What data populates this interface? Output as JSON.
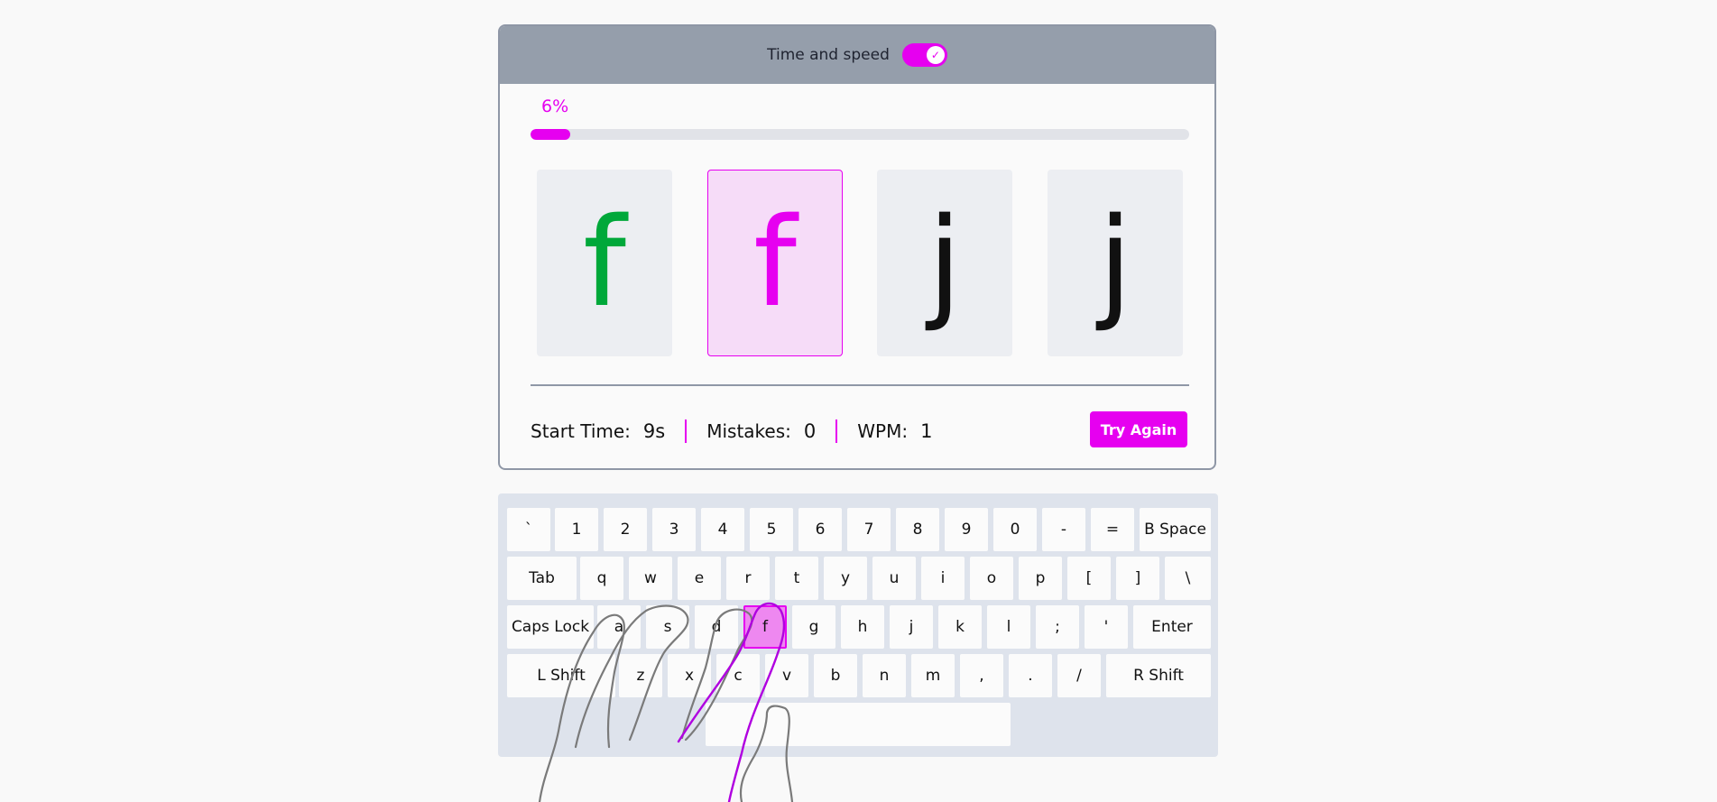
{
  "header": {
    "toggle_label": "Time and speed",
    "toggle_on": true,
    "toggle_check": "✓"
  },
  "progress": {
    "percent_label": "6%",
    "fraction": 0.06
  },
  "letters": [
    {
      "char": "f",
      "state": "done"
    },
    {
      "char": "f",
      "state": "current"
    },
    {
      "char": "j",
      "state": "pending"
    },
    {
      "char": "j",
      "state": "pending"
    }
  ],
  "stats": {
    "start_time_label": "Start Time:",
    "start_time_value": "9s",
    "mistakes_label": "Mistakes:",
    "mistakes_value": "0",
    "wpm_label": "WPM:",
    "wpm_value": "1"
  },
  "try_again_label": "Try Again",
  "keyboard": {
    "rows": [
      [
        "`",
        "1",
        "2",
        "3",
        "4",
        "5",
        "6",
        "7",
        "8",
        "9",
        "0",
        "-",
        "=",
        "B Space"
      ],
      [
        "Tab",
        "q",
        "w",
        "e",
        "r",
        "t",
        "y",
        "u",
        "i",
        "o",
        "p",
        "[",
        "]",
        "\\"
      ],
      [
        "Caps Lock",
        "a",
        "s",
        "d",
        "f",
        "g",
        "h",
        "j",
        "k",
        "l",
        ";",
        "'",
        "Enter"
      ],
      [
        "L Shift",
        "z",
        "x",
        "c",
        "v",
        "b",
        "n",
        "m",
        ",",
        ".",
        "/",
        "R Shift"
      ],
      [
        ""
      ]
    ],
    "active_key": "f"
  },
  "colors": {
    "accent": "#e600f0",
    "correct": "#00a83a",
    "header_bg": "#959eab",
    "finger_outline": "#7a7a7a"
  }
}
